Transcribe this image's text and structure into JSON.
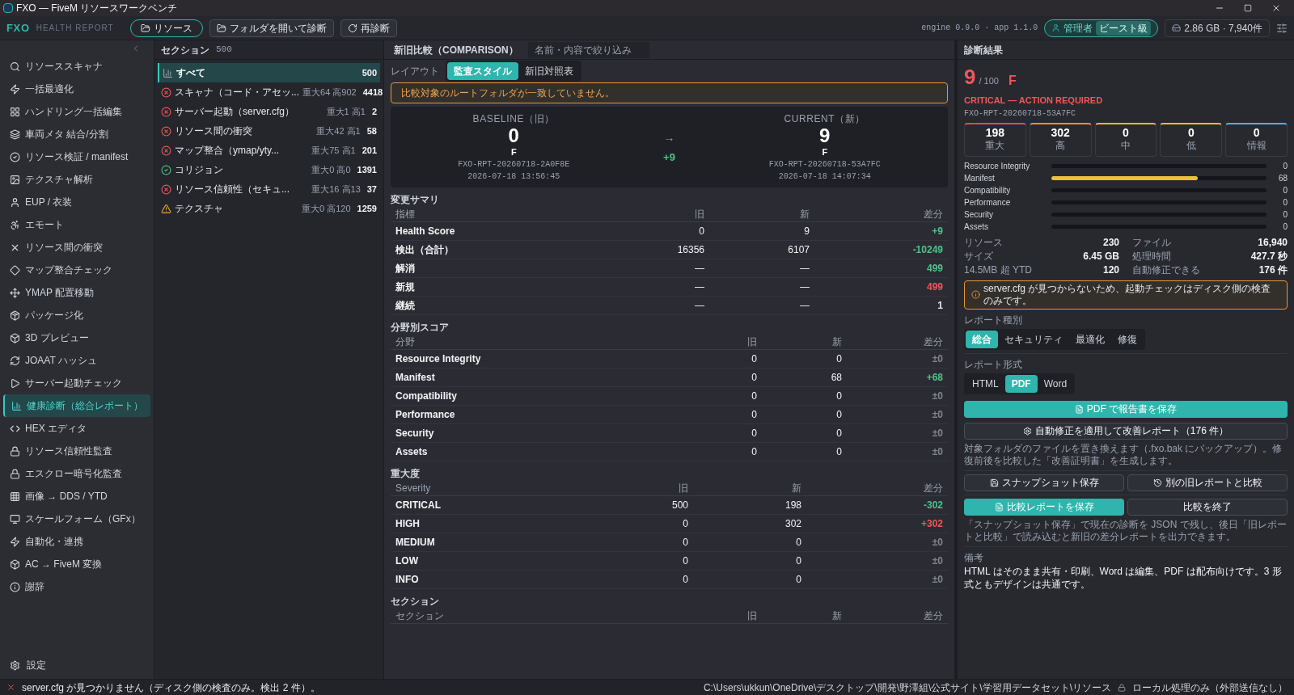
{
  "window": {
    "title": "FXO — FiveM リソースワークベンチ"
  },
  "toolbar": {
    "brand": "FXO",
    "subtitle": "HEALTH REPORT",
    "buttons": [
      {
        "label": "リソース",
        "kind": "pill"
      },
      {
        "label": "フォルダを開いて診断",
        "kind": "folder"
      },
      {
        "label": "再診断",
        "kind": "refresh"
      }
    ],
    "version": "engine 0.9.0 · app 1.1.0",
    "user": "管理者",
    "user_badge": "ビースト級",
    "storage": "2.86 GB · 7,940件"
  },
  "sidebar": {
    "items": [
      {
        "label": "リソーススキャナ",
        "selected": false
      },
      {
        "label": "一括最適化",
        "selected": false
      },
      {
        "label": "ハンドリング一括編集",
        "selected": false
      },
      {
        "label": "車両メタ 結合/分割",
        "selected": false
      },
      {
        "label": "リソース検証 / manifest",
        "selected": false
      },
      {
        "label": "テクスチャ解析",
        "selected": false
      },
      {
        "label": "EUP / 衣装",
        "selected": false
      },
      {
        "label": "エモート",
        "selected": false
      },
      {
        "label": "リソース間の衝突",
        "selected": false
      },
      {
        "label": "マップ整合チェック",
        "selected": false
      },
      {
        "label": "YMAP 配置移動",
        "selected": false
      },
      {
        "label": "パッケージ化",
        "selected": false
      },
      {
        "label": "3D プレビュー",
        "selected": false
      },
      {
        "label": "JOAAT ハッシュ",
        "selected": false
      },
      {
        "label": "サーバー起動チェック",
        "selected": false
      },
      {
        "label": "健康診断（総合レポート）",
        "selected": true
      },
      {
        "label": "HEX エディタ",
        "selected": false
      },
      {
        "label": "リソース信頼性監査",
        "selected": false
      },
      {
        "label": "エスクロー暗号化監査",
        "selected": false
      },
      {
        "label": "画像 → DDS / YTD",
        "selected": false
      },
      {
        "label": "スケールフォーム（GFx）",
        "selected": false
      },
      {
        "label": "自動化・連携",
        "selected": false
      },
      {
        "label": "AC → FiveM 変換",
        "selected": false
      },
      {
        "label": "謝辞",
        "selected": false
      }
    ],
    "footer": "設定"
  },
  "sections": {
    "title": "セクション",
    "count": "500",
    "items": [
      {
        "kind": "all",
        "label": "すべて",
        "count": "500",
        "selected": true
      },
      {
        "kind": "error",
        "label": "スキャナ（コード・アセッ...",
        "meta": "重大64 高902",
        "count": "4418",
        "selected": false
      },
      {
        "kind": "error",
        "label": "サーバー起動（server.cfg）",
        "meta": "重大1 高1",
        "count": "2",
        "selected": false
      },
      {
        "kind": "error",
        "label": "リソース間の衝突",
        "meta": "重大42 高1",
        "count": "58",
        "selected": false
      },
      {
        "kind": "error",
        "label": "マップ整合（ymap/yty...",
        "meta": "重大75 高1",
        "count": "201",
        "selected": false
      },
      {
        "kind": "ok",
        "label": "コリジョン",
        "meta": "重大0 高0",
        "count": "1391",
        "selected": false
      },
      {
        "kind": "error",
        "label": "リソース信頼性（セキュ...",
        "meta": "重大16 高13",
        "count": "37",
        "selected": false
      },
      {
        "kind": "warn",
        "label": "テクスチャ",
        "meta": "重大0 高120",
        "count": "1259",
        "selected": false
      }
    ]
  },
  "comparison": {
    "title": "新旧比較（COMPARISON）",
    "search": {
      "placeholder": "名前・内容で絞り込み"
    },
    "layout_label": "レイアウト",
    "layout_tabs": [
      {
        "label": "監査スタイル",
        "selected": true
      },
      {
        "label": "新旧対照表",
        "selected": false
      }
    ],
    "warning": "比較対象のルートフォルダが一致していません。",
    "baseline": {
      "label": "BASELINE（旧）",
      "score": "0",
      "grade": "F",
      "id": "FXO-RPT-20260718-2A0F8E",
      "time": "2026-07-18 13:56:45"
    },
    "arrow": "→",
    "delta": "+9",
    "current": {
      "label": "CURRENT（新）",
      "score": "9",
      "grade": "F",
      "id": "FXO-RPT-20260718-53A7FC",
      "time": "2026-07-18 14:07:34"
    },
    "tables": [
      {
        "title": "変更サマリ",
        "columns": [
          "指標",
          "旧",
          "新",
          "差分"
        ],
        "rows": [
          {
            "cells": [
              "Health Score",
              "0",
              "9",
              "+9"
            ],
            "color": "#4cc38a"
          },
          {
            "cells": [
              "検出（合計）",
              "16356",
              "6107",
              "-10249"
            ],
            "color": "#4cc38a"
          },
          {
            "cells": [
              "解消",
              "—",
              "—",
              "499"
            ],
            "color": "#4cc38a"
          },
          {
            "cells": [
              "新規",
              "—",
              "—",
              "499"
            ],
            "color": "#f0565a"
          },
          {
            "cells": [
              "継続",
              "—",
              "—",
              "1"
            ],
            "color": "#e5e7eb"
          }
        ]
      },
      {
        "title": "分野別スコア",
        "columns": [
          "分野",
          "旧",
          "新",
          "差分"
        ],
        "rows": [
          {
            "cells": [
              "Resource Integrity",
              "0",
              "0",
              "±0"
            ],
            "color": "#80848e"
          },
          {
            "cells": [
              "Manifest",
              "0",
              "68",
              "+68"
            ],
            "color": "#4cc38a"
          },
          {
            "cells": [
              "Compatibility",
              "0",
              "0",
              "±0"
            ],
            "color": "#80848e"
          },
          {
            "cells": [
              "Performance",
              "0",
              "0",
              "±0"
            ],
            "color": "#80848e"
          },
          {
            "cells": [
              "Security",
              "0",
              "0",
              "±0"
            ],
            "color": "#80848e"
          },
          {
            "cells": [
              "Assets",
              "0",
              "0",
              "±0"
            ],
            "color": "#80848e"
          }
        ]
      },
      {
        "title": "重大度",
        "columns": [
          "Severity",
          "旧",
          "新",
          "差分"
        ],
        "rows": [
          {
            "cells": [
              "CRITICAL",
              "500",
              "198",
              "-302"
            ],
            "color": "#4cc38a"
          },
          {
            "cells": [
              "HIGH",
              "0",
              "302",
              "+302"
            ],
            "color": "#f0565a"
          },
          {
            "cells": [
              "MEDIUM",
              "0",
              "0",
              "±0"
            ],
            "color": "#80848e"
          },
          {
            "cells": [
              "LOW",
              "0",
              "0",
              "±0"
            ],
            "color": "#80848e"
          },
          {
            "cells": [
              "INFO",
              "0",
              "0",
              "±0"
            ],
            "color": "#80848e"
          }
        ]
      },
      {
        "title": "セクション",
        "columns": [
          "セクション",
          "旧",
          "新",
          "差分"
        ]
      }
    ]
  },
  "result": {
    "title": "診断結果",
    "score": "9",
    "max": "/ 100",
    "grade": "F",
    "status": "CRITICAL — ACTION REQUIRED",
    "id": "FXO-RPT-20260718-53A7FC",
    "severity_cards": [
      {
        "value": "198",
        "label": "重大",
        "color": "#e5484d"
      },
      {
        "value": "302",
        "label": "高",
        "color": "#f08a3c"
      },
      {
        "value": "0",
        "label": "中",
        "color": "#e8b43a"
      },
      {
        "value": "0",
        "label": "低",
        "color": "#d9c23a"
      },
      {
        "value": "0",
        "label": "情報",
        "color": "#5aa9e6"
      }
    ],
    "bars": [
      {
        "label": "Resource Integrity",
        "value": "0"
      },
      {
        "label": "Manifest",
        "level": 0.68,
        "value": "68"
      },
      {
        "label": "Compatibility",
        "value": "0"
      },
      {
        "label": "Performance",
        "value": "0"
      },
      {
        "label": "Security",
        "value": "0"
      },
      {
        "label": "Assets",
        "value": "0"
      }
    ],
    "stats": [
      {
        "label": "リソース",
        "value": "230"
      },
      {
        "label": "ファイル",
        "value": "16,940"
      },
      {
        "label": "サイズ",
        "value": "6.45 GB"
      },
      {
        "label": "処理時間",
        "value": "427.7 秒"
      },
      {
        "label": "14.5MB 超 YTD",
        "value": "120"
      },
      {
        "label": "自動修正できる",
        "value": "176 件"
      }
    ],
    "warning": "server.cfg が見つからないため、起動チェックはディスク側の検査のみです。",
    "type_label": "レポート種別",
    "types": [
      {
        "label": "総合",
        "selected": true
      },
      {
        "label": "セキュリティ",
        "selected": false
      },
      {
        "label": "最適化",
        "selected": false
      },
      {
        "label": "修復",
        "selected": false
      }
    ],
    "format_label": "レポート形式",
    "formats": [
      {
        "label": "HTML",
        "selected": false
      },
      {
        "label": "PDF",
        "selected": true
      },
      {
        "label": "Word",
        "selected": false
      }
    ],
    "save_button": "PDF で報告書を保存",
    "autofix_button": "自動修正を適用して改善レポート（176 件）",
    "autofix_note": "対象フォルダのファイルを置き換えます（.fxo.bak にバックアップ）。修復前後を比較した「改善証明書」を生成します。",
    "snapshot_button": "スナップショット保存",
    "compare_button": "別の旧レポートと比較",
    "save_compare_button": "比較レポートを保存",
    "end_compare_button": "比較を終了",
    "snapshot_note": "「スナップショット保存」で現在の診断を JSON で残し、後日「旧レポートと比較」で読み込むと新旧の差分レポートを出力できます。",
    "remarks_label": "備考",
    "remarks": "HTML はそのまま共有・印刷、Word は編集、PDF は配布向けです。3 形式ともデザインは共通です。"
  },
  "status_bar": {
    "message": "server.cfg が見つかりません（ディスク側の検査のみ。検出 2 件）。",
    "path": "C:\\Users\\ukkun\\OneDrive\\デスクトップ\\開発\\野澤組\\公式サイト\\学習用データセット\\リソース",
    "privacy": "ローカル処理のみ（外部送信なし）"
  }
}
